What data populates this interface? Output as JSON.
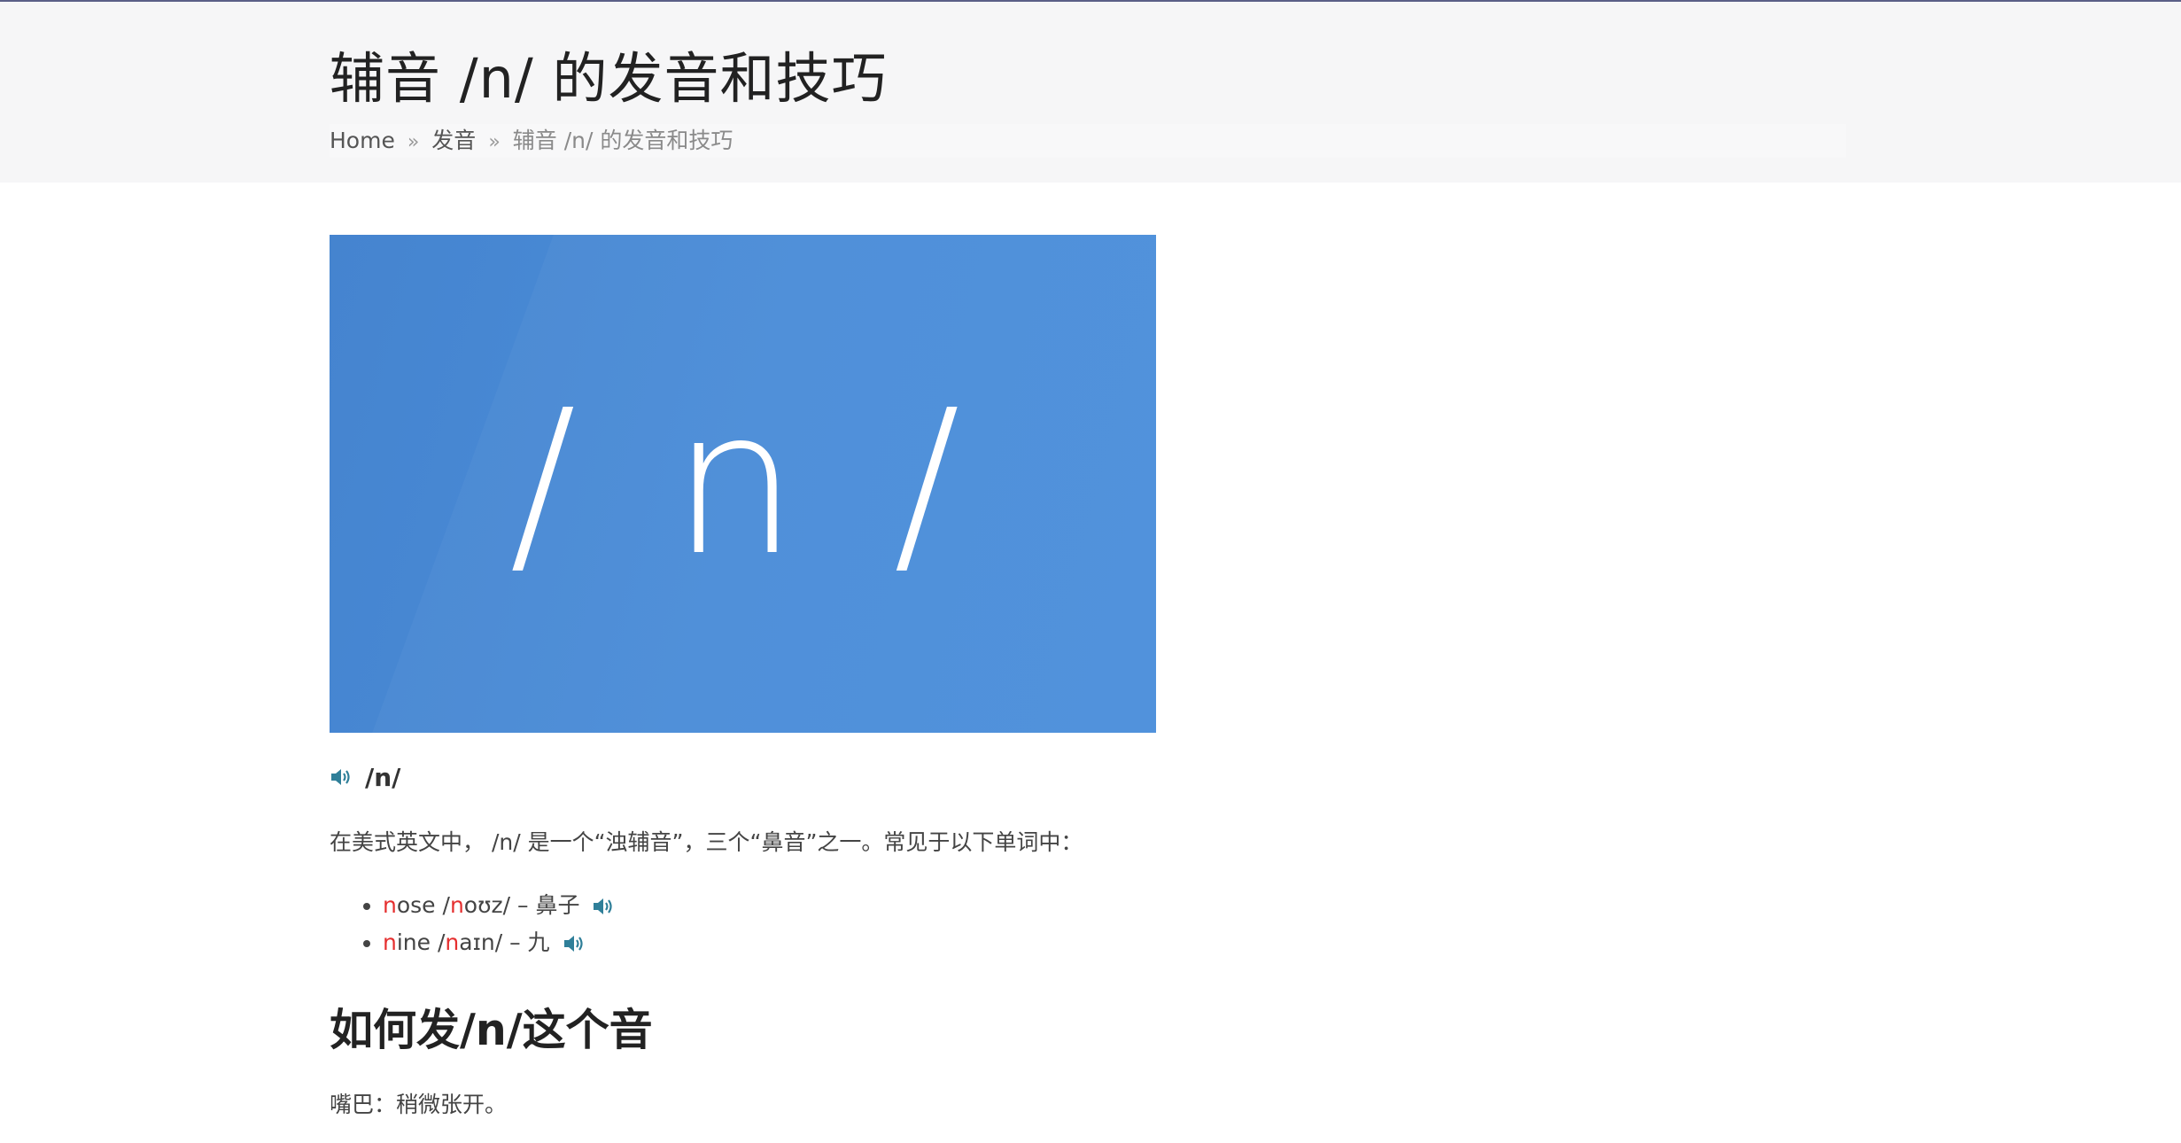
{
  "page": {
    "title": "辅音 /n/ 的发音和技巧"
  },
  "breadcrumb": {
    "home": "Home",
    "separator": "»",
    "category": "发音",
    "current": "辅音 /n/ 的发音和技巧"
  },
  "hero": {
    "text": "/ n /",
    "background_color": "#4a8cd8"
  },
  "phoneme": {
    "icon": "speaker-icon",
    "label": "/n/"
  },
  "intro": "在美式英文中， /n/ 是一个“浊辅音”，三个“鼻音”之一。常见于以下单词中：",
  "words": [
    {
      "highlight": "n",
      "rest": "ose",
      "ipa_prefix": " /",
      "ipa_highlight": "n",
      "ipa_rest": "oʊz/",
      "meaning": " – 鼻子",
      "icon": "speaker-icon"
    },
    {
      "highlight": "n",
      "rest": "ine",
      "ipa_prefix": " /",
      "ipa_highlight": "n",
      "ipa_rest": "aɪn/",
      "meaning": " – 九",
      "icon": "speaker-icon"
    }
  ],
  "section": {
    "heading": "如何发/n/这个音",
    "mouth": "嘴巴：稍微张开。"
  },
  "colors": {
    "accent_red": "#e52f2f",
    "speaker_teal": "#2f7f99",
    "header_bg": "#f6f6f7"
  }
}
